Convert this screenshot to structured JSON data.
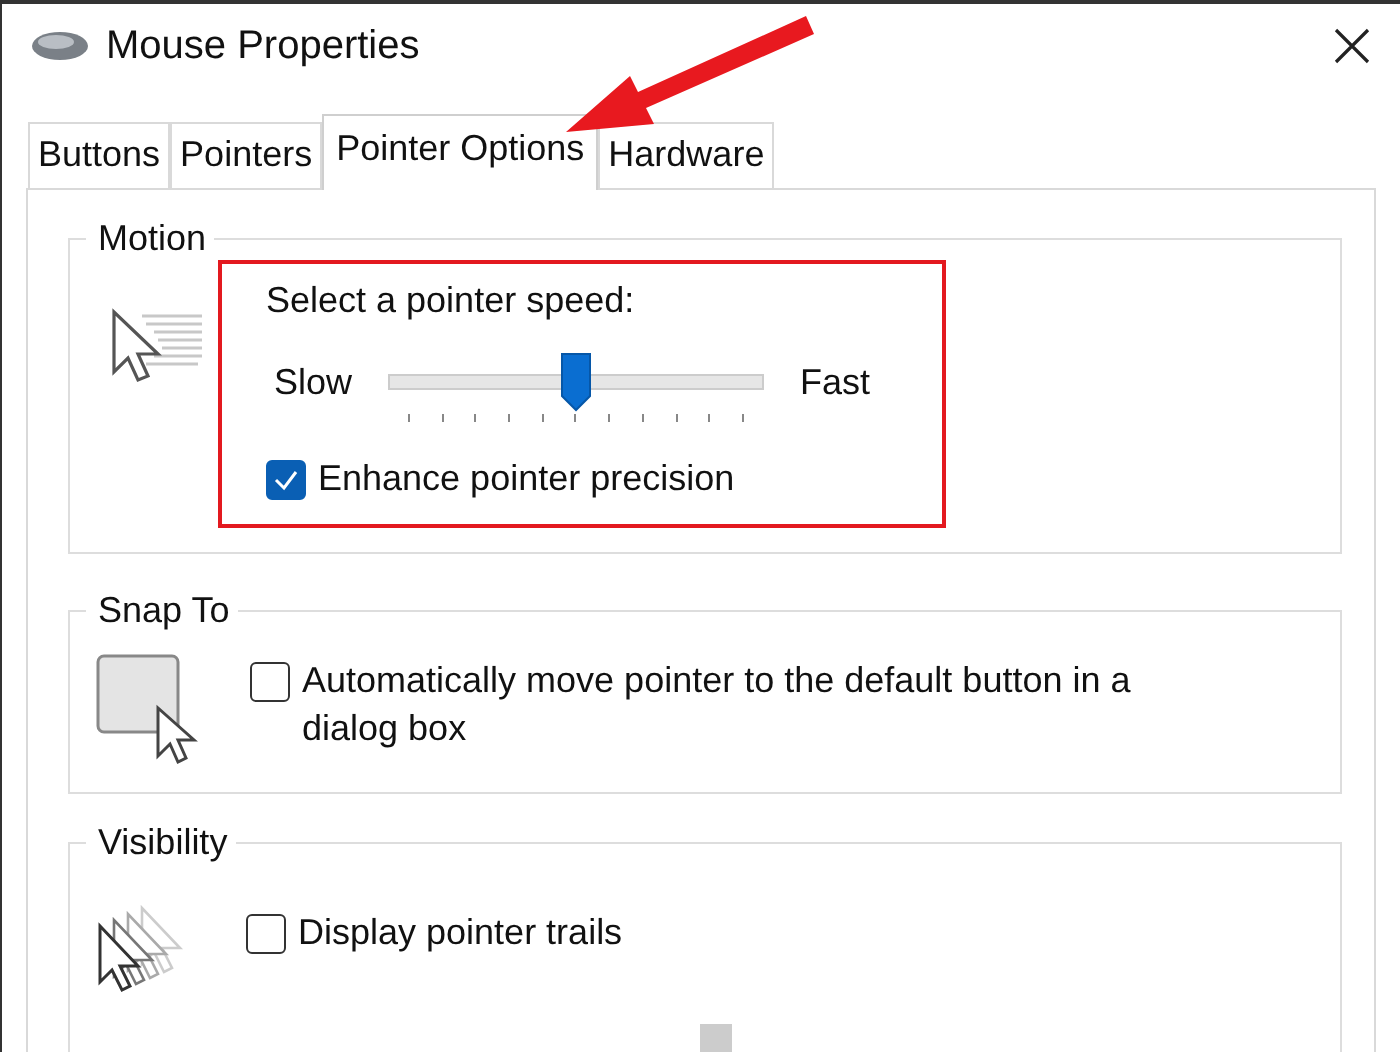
{
  "window": {
    "title": "Mouse Properties"
  },
  "tabs": [
    {
      "label": "Buttons",
      "selected": false
    },
    {
      "label": "Pointers",
      "selected": false
    },
    {
      "label": "Pointer Options",
      "selected": true
    },
    {
      "label": "Hardware",
      "selected": false
    }
  ],
  "motion": {
    "title": "Motion",
    "speed_label": "Select a pointer speed:",
    "slow_label": "Slow",
    "fast_label": "Fast",
    "speed": {
      "level": 0.5
    },
    "enhance_precision": {
      "label": "Enhance pointer precision",
      "checked": true
    }
  },
  "snap_to": {
    "title": "Snap To",
    "option": {
      "label": "Automatically move pointer to the default button in a dialog box",
      "checked": false
    }
  },
  "visibility": {
    "title": "Visibility",
    "option": {
      "label": "Display pointer trails",
      "checked": false
    }
  }
}
